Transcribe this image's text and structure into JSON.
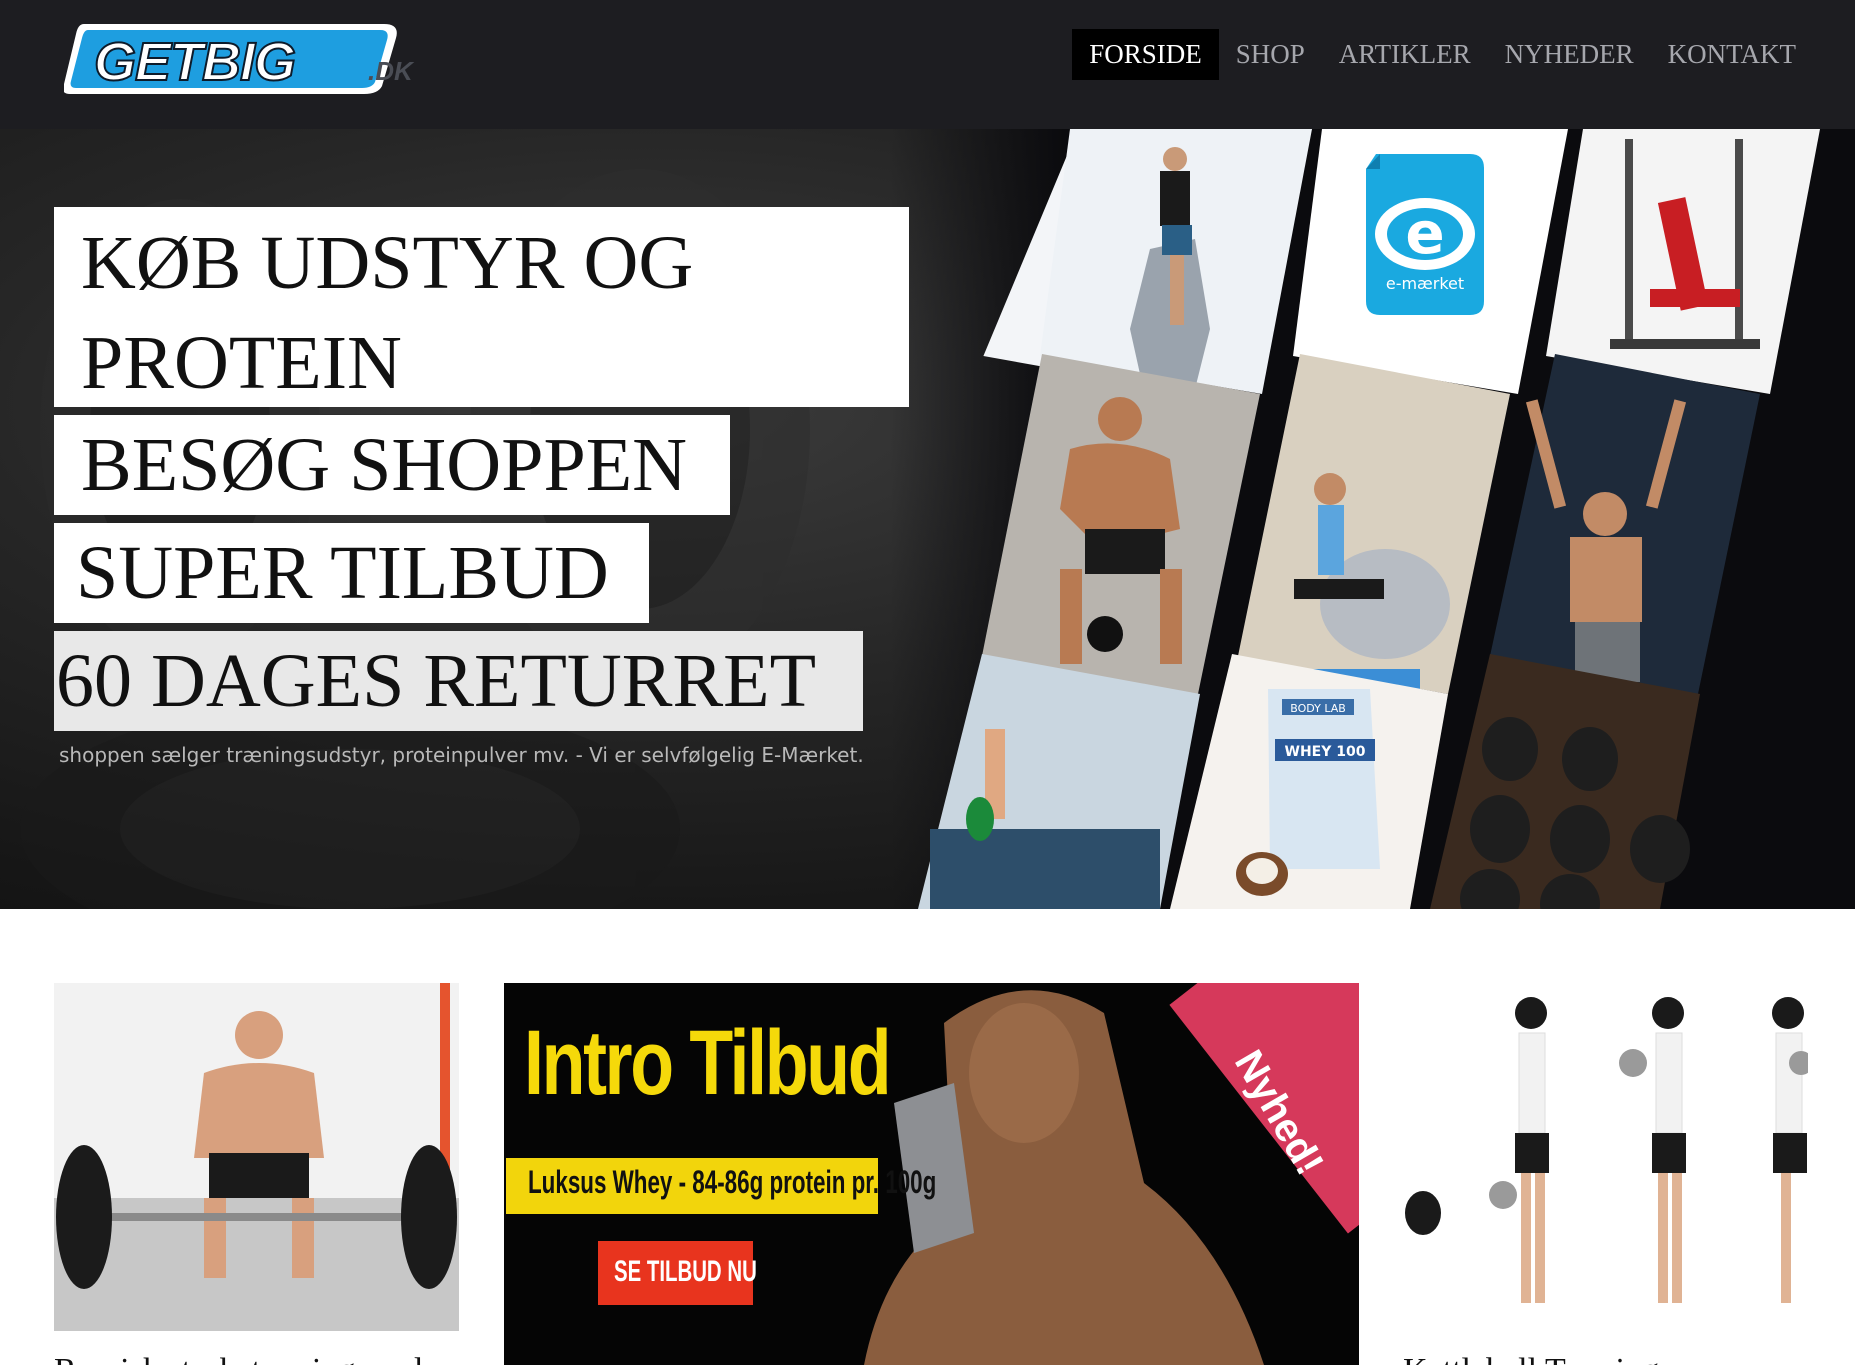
{
  "brand": {
    "logo_text": "GETBIG",
    "logo_suffix": ".DK",
    "colors": {
      "header_bg": "#1d1d21",
      "logo_blue": "#1e9ee0",
      "promo_yellow": "#f5d90a",
      "promo_red": "#e8341e",
      "ribbon_pink": "#d6395b"
    }
  },
  "nav": {
    "items": [
      {
        "label": "FORSIDE",
        "active": true
      },
      {
        "label": "SHOP",
        "active": false
      },
      {
        "label": "ARTIKLER",
        "active": false
      },
      {
        "label": "NYHEDER",
        "active": false
      },
      {
        "label": "KONTAKT",
        "active": false
      }
    ]
  },
  "hero": {
    "headline_line1": "KØB UDSTYR OG",
    "headline_line2": "PROTEIN",
    "line3": "BESØG SHOPPEN",
    "line4": "SUPER TILBUD",
    "line5": "60 DAGES RETURRET",
    "subtitle": "shoppen sælger træningsudstyr, proteinpulver mv. - Vi er selvfølgelig E-Mærket.",
    "tiles": {
      "emaerket_label": "e-mærket",
      "whey_label": "WHEY 100",
      "whey_brand": "BODY LAB"
    }
  },
  "cards": [
    {
      "title": "Russisk styrketræning med"
    },
    {
      "promo_title": "Intro Tilbud",
      "promo_subtitle": "Luksus Whey - 84-86g protein pr. 100g",
      "promo_button": "SE TILBUD NU",
      "promo_badge": "Nyhed!"
    },
    {
      "title": "Kettlebell Træning"
    }
  ]
}
